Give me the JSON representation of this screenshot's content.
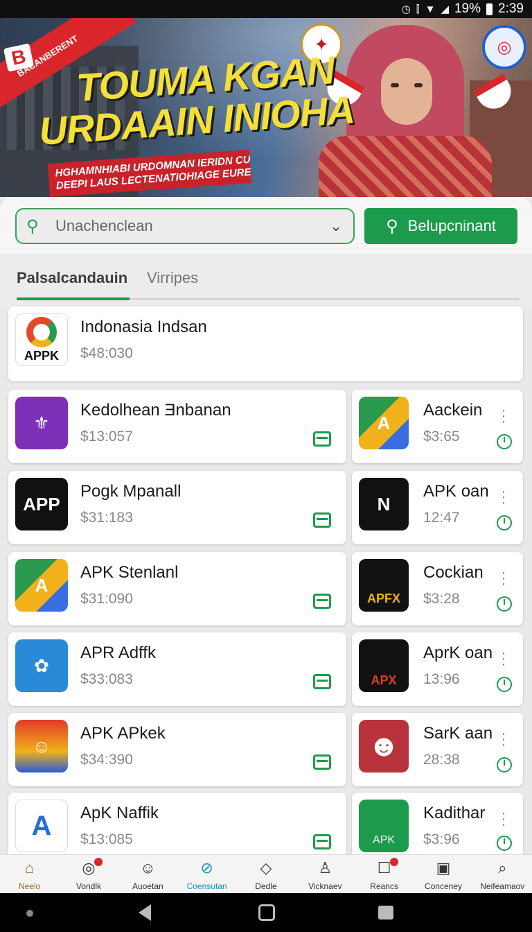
{
  "status_bar": {
    "signal": "19%",
    "time": "2:39"
  },
  "banner": {
    "corner_label": "BACANBERENT",
    "corner_logo": "B",
    "headline_1": "TOUMA KGAN",
    "headline_2": "URDAAIN INIOHA",
    "subtitle_1": "HGHAMNHIABI URDOMNAN IERIDN CUGH",
    "subtitle_2": "DEEPI LAUS LECTENATIOHIAGE EURETRDPF"
  },
  "search": {
    "placeholder": "Unachenclean",
    "button_label": "Belupcninant"
  },
  "tabs": [
    {
      "label": "Palsalcandauin"
    },
    {
      "label": "Virripes"
    }
  ],
  "featured": {
    "name": "Indonasia Indsan",
    "price": "$48:030",
    "icon_text": "APPK"
  },
  "left_list": [
    {
      "name": "Kedolhean Ǝnbanan",
      "price": "$13:057"
    },
    {
      "name": "Pogk Mpanall",
      "price": "$31:183"
    },
    {
      "name": "APK Stenlanl",
      "price": "$31:090"
    },
    {
      "name": "APR Adffk",
      "price": "$33:083"
    },
    {
      "name": "APK APkek",
      "price": "$34:390"
    },
    {
      "name": "ApK Naffik",
      "price": "$13:085"
    }
  ],
  "right_list": [
    {
      "name": "Aackein",
      "price": "$3:65"
    },
    {
      "name": "APK oan",
      "price": "12:47"
    },
    {
      "name": "Cockian",
      "price": "$3:28"
    },
    {
      "name": "AprK oan",
      "price": "13:96"
    },
    {
      "name": "SarK aan",
      "price": "28:38"
    },
    {
      "name": "Kadithar",
      "price": "$3:96"
    }
  ],
  "icons": {
    "left_1": "⚜",
    "left_2": "APP",
    "left_3": "A",
    "left_4": "✿",
    "left_5": "☺",
    "left_6": "A",
    "right_1": "A",
    "right_2": "N",
    "right_3": "APFX",
    "right_4": "APX",
    "right_5": "☻",
    "right_6": "APK"
  },
  "bottom_nav": [
    {
      "label": "Neelo",
      "icon": "⌂"
    },
    {
      "label": "Vondlk",
      "icon": "◎"
    },
    {
      "label": "Auoetan",
      "icon": "☺"
    },
    {
      "label": "Coensutan",
      "icon": "⊘"
    },
    {
      "label": "Dedle",
      "icon": "◇"
    },
    {
      "label": "Vicknaev",
      "icon": "♙"
    },
    {
      "label": "Reancs",
      "icon": "☐"
    },
    {
      "label": "Conceney",
      "icon": "▣"
    },
    {
      "label": "Neifeamaov",
      "icon": "⌕"
    }
  ],
  "colors": {
    "accent": "#1d9b4c",
    "banner_red": "#d8262b",
    "headline_yellow": "#f5e03a"
  }
}
